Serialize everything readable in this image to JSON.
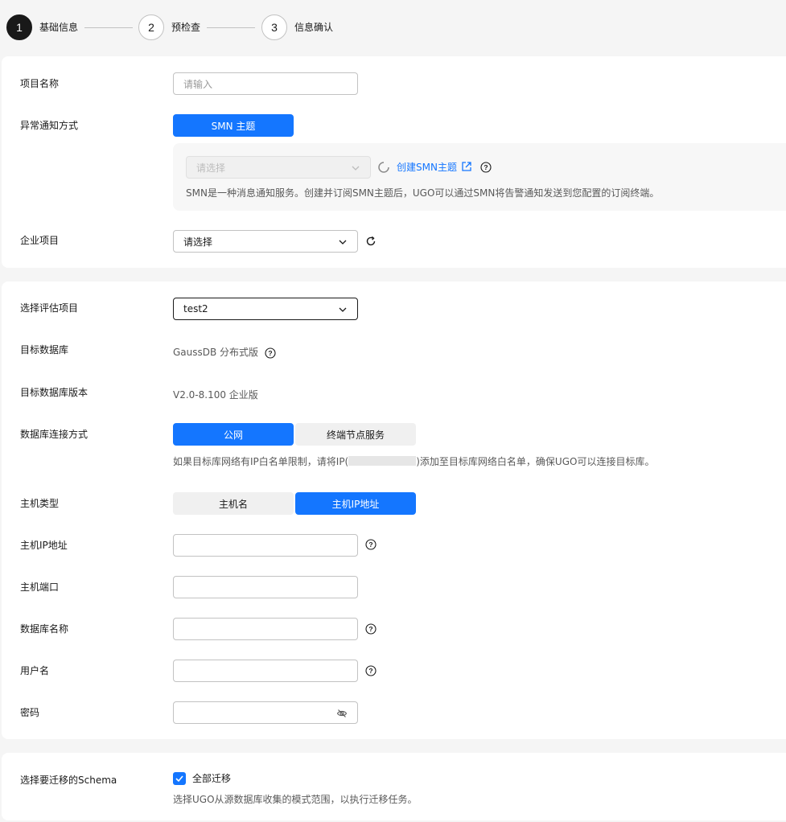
{
  "steps": [
    {
      "num": "1",
      "label": "基础信息"
    },
    {
      "num": "2",
      "label": "预检查"
    },
    {
      "num": "3",
      "label": "信息确认"
    }
  ],
  "section1": {
    "project_name_label": "项目名称",
    "project_name_placeholder": "请输入",
    "notify_label": "异常通知方式",
    "smn_button": "SMN 主题",
    "smn_select_placeholder": "请选择",
    "create_smn_link": "创建SMN主题",
    "smn_hint": "SMN是一种消息通知服务。创建并订阅SMN主题后，UGO可以通过SMN将告警通知发送到您配置的订阅终端。",
    "enterprise_label": "企业项目",
    "enterprise_value": "请选择"
  },
  "section2": {
    "assess_label": "选择评估项目",
    "assess_value": "test2",
    "target_db_label": "目标数据库",
    "target_db_value": "GaussDB 分布式版",
    "target_ver_label": "目标数据库版本",
    "target_ver_value": "V2.0-8.100 企业版",
    "conn_label": "数据库连接方式",
    "conn_public": "公网",
    "conn_endpoint": "终端节点服务",
    "conn_hint_pre": "如果目标库网络有IP白名单限制，请将IP(",
    "conn_hint_post": ")添加至目标库网络白名单，确保UGO可以连接目标库。",
    "host_type_label": "主机类型",
    "host_name_btn": "主机名",
    "host_ip_btn": "主机IP地址",
    "host_ip_label": "主机IP地址",
    "host_port_label": "主机端口",
    "db_name_label": "数据库名称",
    "username_label": "用户名",
    "password_label": "密码"
  },
  "section3": {
    "schema_label": "选择要迁移的Schema",
    "migrate_all": "全部迁移",
    "schema_hint": "选择UGO从源数据库收集的模式范围，以执行迁移任务。"
  },
  "colors": {
    "accent": "#1476ff",
    "step_active": "#191919"
  },
  "icons": [
    "help-icon",
    "chevron-down-icon",
    "refresh-icon",
    "loading-spinner-icon",
    "external-link-icon",
    "eye-off-icon",
    "check-icon"
  ]
}
